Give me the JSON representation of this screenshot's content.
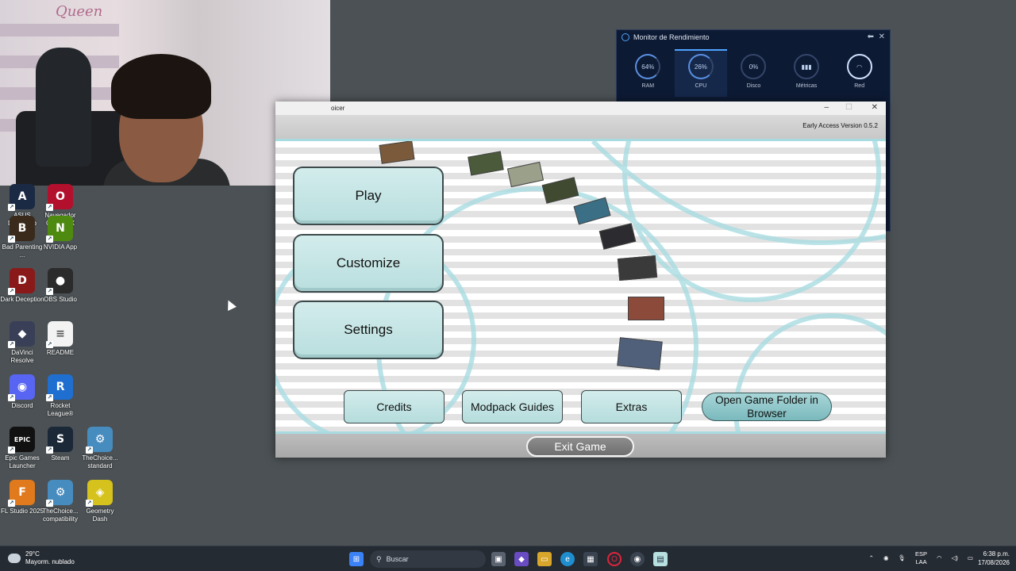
{
  "desktop": {
    "icons": [
      {
        "label": "ASUS DriverHub",
        "glyph": "A",
        "color": "#1b2a44",
        "icon": "asus-icon"
      },
      {
        "label": "Navegador Opera GX",
        "glyph": "O",
        "color": "#b3102d",
        "icon": "opera-gx-icon"
      },
      {
        "label": "Bad Parenting ...",
        "glyph": "B",
        "color": "#3a2a1c",
        "icon": "bad-parenting-icon"
      },
      {
        "label": "NVIDIA App",
        "glyph": "N",
        "color": "#4f8a10",
        "icon": "nvidia-icon"
      },
      {
        "label": "Dark Deception",
        "glyph": "D",
        "color": "#8a1a1a",
        "icon": "dark-deception-icon"
      },
      {
        "label": "OBS Studio",
        "glyph": "●",
        "color": "#2b2b2b",
        "icon": "obs-icon"
      },
      {
        "label": "DaVinci Resolve",
        "glyph": "◆",
        "color": "#3a3f58",
        "icon": "davinci-icon"
      },
      {
        "label": "README",
        "glyph": "≡",
        "color": "#f3f3f3",
        "icon": "document-icon"
      },
      {
        "label": "Discord",
        "glyph": "◉",
        "color": "#5865f2",
        "icon": "discord-icon"
      },
      {
        "label": "Rocket League®",
        "glyph": "R",
        "color": "#1f6fd1",
        "icon": "rocket-league-icon"
      },
      {
        "label": "Epic Games Launcher",
        "glyph": "EPIC",
        "color": "#111111",
        "icon": "epic-games-icon"
      },
      {
        "label": "Steam",
        "glyph": "S",
        "color": "#1b2838",
        "icon": "steam-icon"
      },
      {
        "label": "TheChoice... standard",
        "glyph": "⚙",
        "color": "#478cbf",
        "icon": "godot-icon"
      },
      {
        "label": "FL Studio 2025",
        "glyph": "F",
        "color": "#e07a1c",
        "icon": "fl-studio-icon"
      },
      {
        "label": "TheChoice... compatibility",
        "glyph": "⚙",
        "color": "#478cbf",
        "icon": "godot-icon"
      },
      {
        "label": "Geometry Dash",
        "glyph": "◈",
        "color": "#d6c21c",
        "icon": "geometry-dash-icon"
      }
    ]
  },
  "webcam": {
    "wall_text": "Queen"
  },
  "perf_monitor": {
    "title": "Monitor de Rendimiento",
    "gauges": [
      {
        "label": "RAM",
        "value": "64%"
      },
      {
        "label": "CPU",
        "value": "26%"
      },
      {
        "label": "Disco",
        "value": "0%"
      },
      {
        "label": "Métricas",
        "value": "▮▮▮"
      },
      {
        "label": "Red",
        "value": "◠"
      }
    ]
  },
  "game": {
    "window_title": "oicer",
    "version": "Early Access Version 0.5.2",
    "buttons": {
      "play": "Play",
      "customize": "Customize",
      "settings": "Settings",
      "credits": "Credits",
      "modpack_guides": "Modpack Guides",
      "extras": "Extras",
      "open_folder": "Open Game Folder in Browser",
      "exit": "Exit Game"
    }
  },
  "taskbar": {
    "weather_temp": "29°C",
    "weather_desc": "Mayorm. nublado",
    "search_placeholder": "Buscar",
    "lang_top": "ESP",
    "lang_bottom": "LAA",
    "time": "6:38 p.m.",
    "date": "17/08/2026"
  },
  "colors": {
    "game_button": "#c8e6e6",
    "accent_cyan": "#a8dbe0",
    "monitor_bg": "#0d1a33",
    "taskbar_bg": "#252b33"
  }
}
